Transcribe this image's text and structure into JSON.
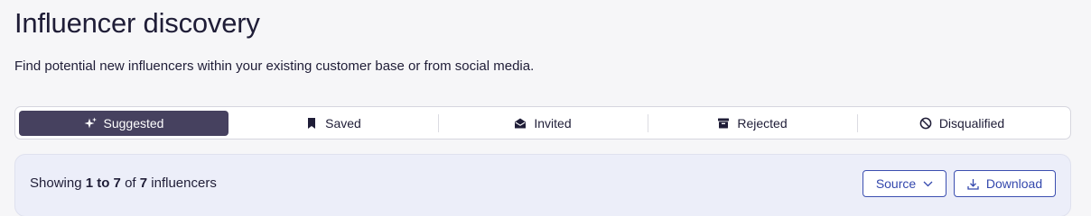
{
  "header": {
    "title": "Influencer discovery",
    "subtitle": "Find potential new influencers within your existing customer base or from social media."
  },
  "tabs": [
    {
      "label": "Suggested",
      "icon": "sparkle-icon",
      "active": true
    },
    {
      "label": "Saved",
      "icon": "bookmark-icon",
      "active": false
    },
    {
      "label": "Invited",
      "icon": "envelope-open-icon",
      "active": false
    },
    {
      "label": "Rejected",
      "icon": "archive-icon",
      "active": false
    },
    {
      "label": "Disqualified",
      "icon": "ban-icon",
      "active": false
    }
  ],
  "results": {
    "prefix": "Showing",
    "range": "1 to 7",
    "of_word": "of",
    "total": "7",
    "suffix": "influencers"
  },
  "toolbar": {
    "source_label": "Source",
    "download_label": "Download"
  },
  "colors": {
    "accent": "#46415f",
    "link": "#3448ad",
    "panel_bg": "#eceef9"
  }
}
